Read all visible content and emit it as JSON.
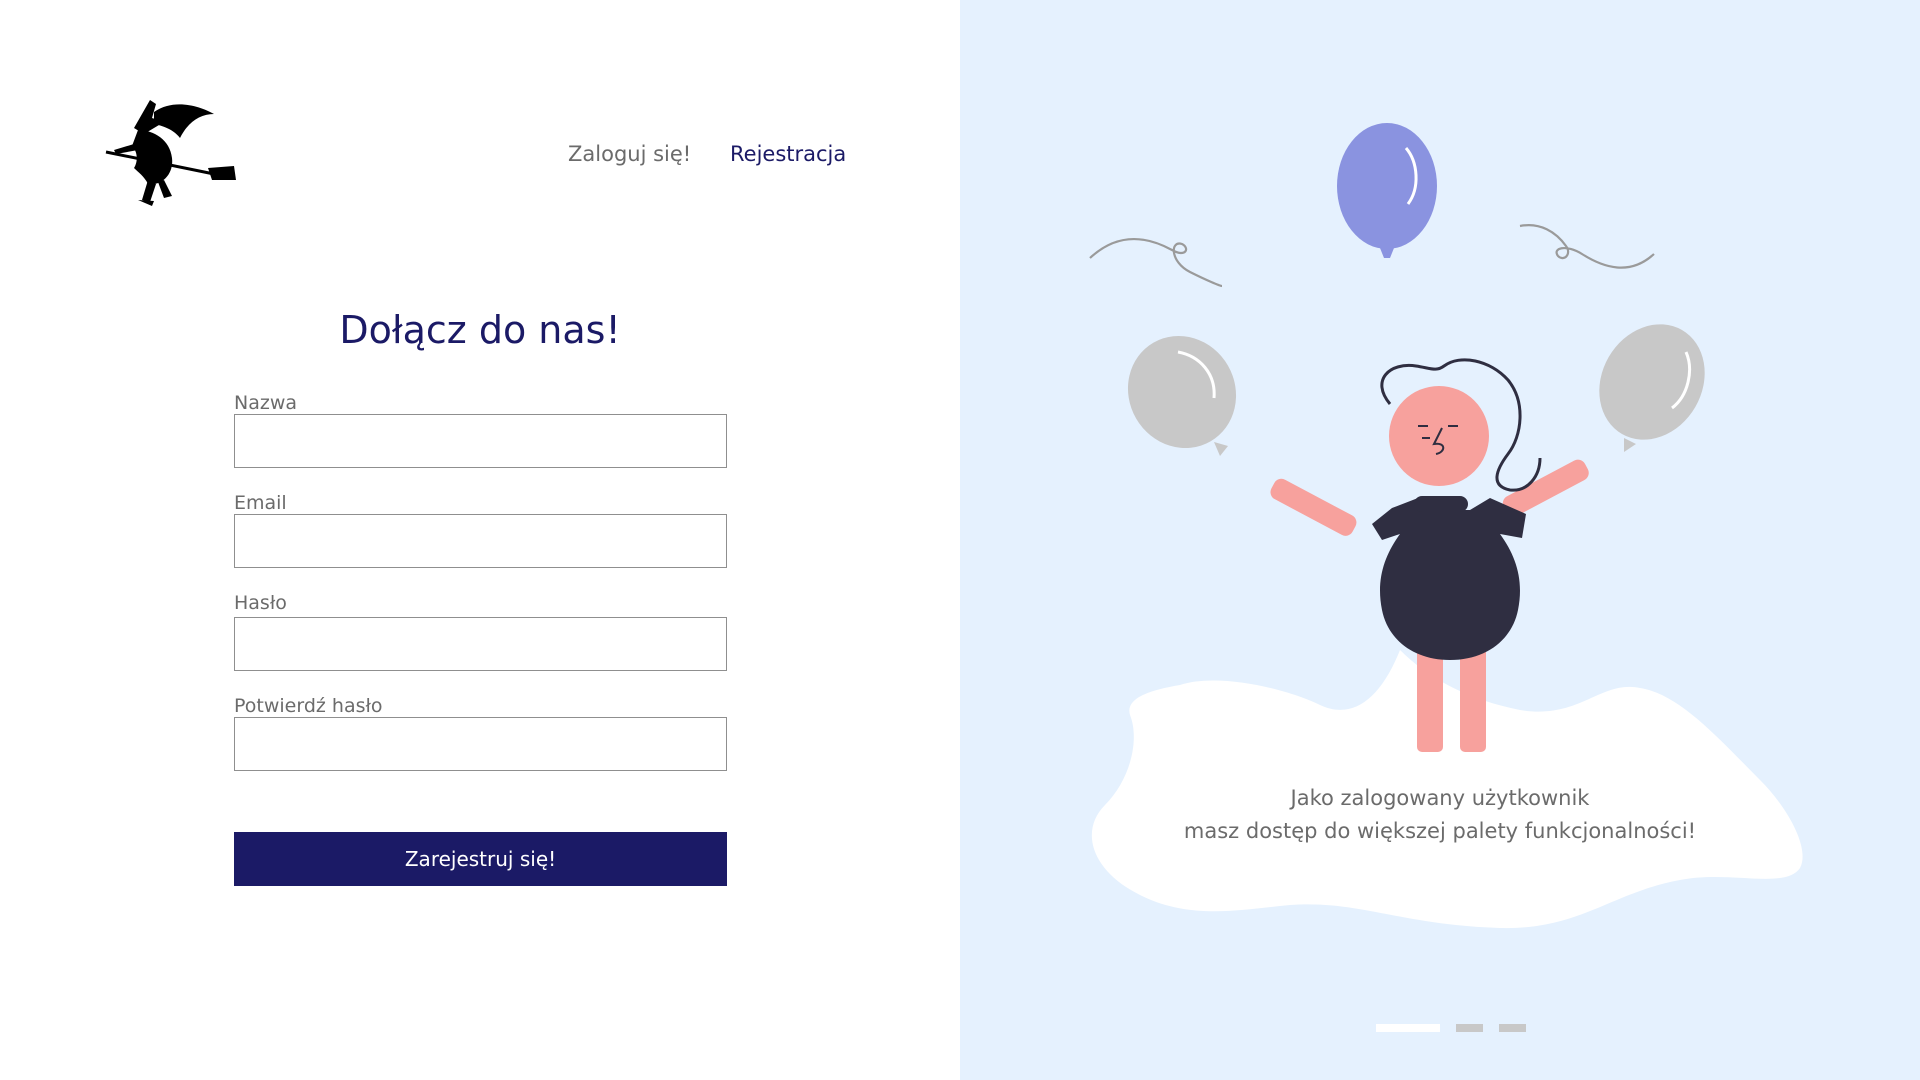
{
  "nav": {
    "login_label": "Zaloguj się!",
    "register_label": "Rejestracja"
  },
  "form": {
    "title": "Dołącz do nas!",
    "fields": [
      {
        "label": "Nazwa",
        "value": "",
        "placeholder": ""
      },
      {
        "label": "Email",
        "value": "",
        "placeholder": ""
      },
      {
        "label": "Hasło",
        "value": "",
        "placeholder": ""
      },
      {
        "label": "Potwierdź hasło",
        "value": "",
        "placeholder": ""
      }
    ],
    "submit_label": "Zarejestruj się!"
  },
  "promo": {
    "line1": "Jako zalogowany użytkownik",
    "line2": "masz dostęp do większej palety funkcjonalności!"
  },
  "carousel": {
    "slide_count": 3,
    "active_index": 0
  },
  "icons": {
    "logo": "witch-on-broom-logo",
    "illustration": "person-with-balloons"
  },
  "colors": {
    "brand": "#1b1a66",
    "right_background": "#e5f1fe",
    "balloon_accent": "#8a93e0",
    "balloon_gray": "#c8c8c8",
    "skin": "#f7a19d",
    "shirt": "#2f2e41"
  }
}
